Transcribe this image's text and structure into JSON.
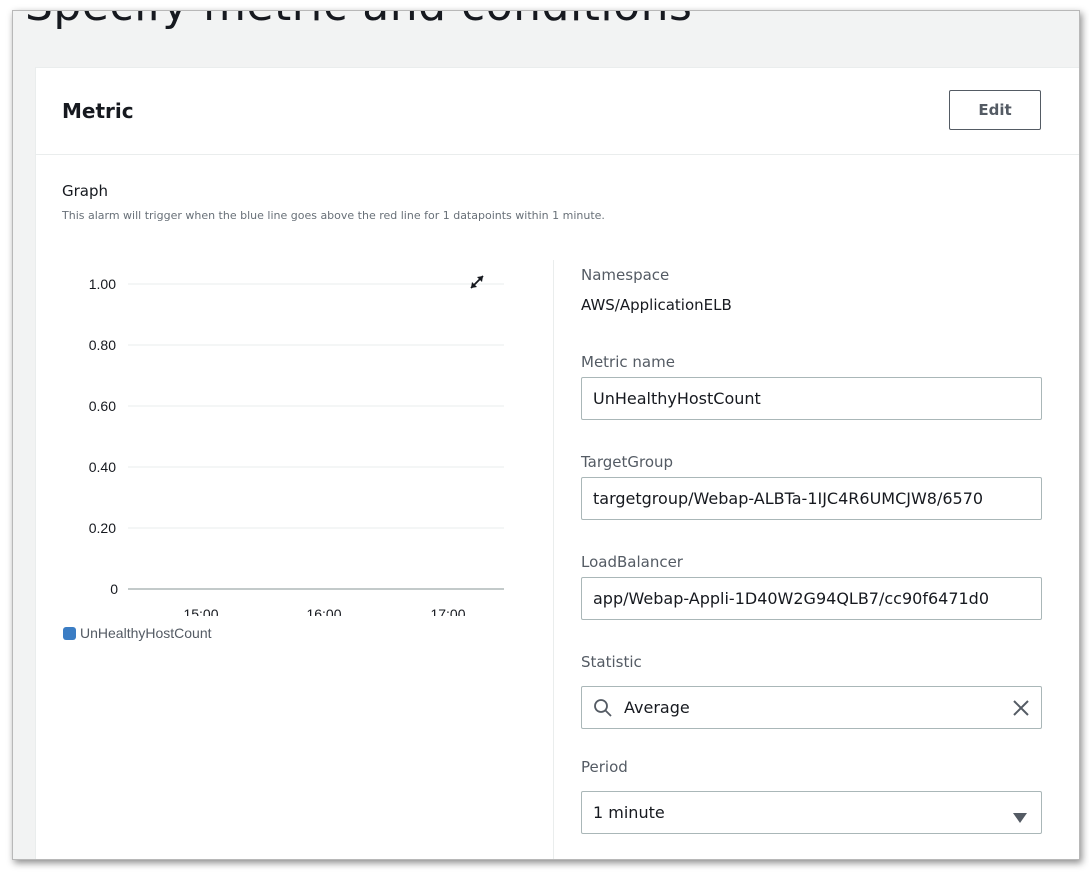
{
  "page": {
    "heading": "Specify metric and conditions"
  },
  "metric_card": {
    "title": "Metric",
    "edit_label": "Edit"
  },
  "graph": {
    "label": "Graph",
    "description": "This alarm will trigger when the blue line goes above the red line for 1 datapoints within 1 minute.",
    "expand_icon": "expand-icon"
  },
  "fields": {
    "namespace_label": "Namespace",
    "namespace_value": "AWS/ApplicationELB",
    "metric_name_label": "Metric name",
    "metric_name_value": "UnHealthyHostCount",
    "target_group_label": "TargetGroup",
    "target_group_value": "targetgroup/Webap-ALBTa-1IJC4R6UMCJW8/6570",
    "load_balancer_label": "LoadBalancer",
    "load_balancer_value": "app/Webap-Appli-1D40W2G94QLB7/cc90f6471d0",
    "statistic_label": "Statistic",
    "statistic_value": "Average",
    "period_label": "Period",
    "period_value": "1 minute"
  },
  "colors": {
    "series": "#3b7dc4",
    "accent_border": "#aab7b8"
  },
  "chart_data": {
    "type": "line",
    "title": "",
    "xlabel": "",
    "ylabel": "",
    "ylim": [
      0,
      1
    ],
    "y_ticks": [
      "1.00",
      "0.80",
      "0.60",
      "0.40",
      "0.20",
      "0"
    ],
    "x_ticks": [
      "15:00",
      "16:00",
      "17:00"
    ],
    "grid": true,
    "legend": "bottom-left",
    "series": [
      {
        "name": "UnHealthyHostCount",
        "values": []
      }
    ]
  }
}
